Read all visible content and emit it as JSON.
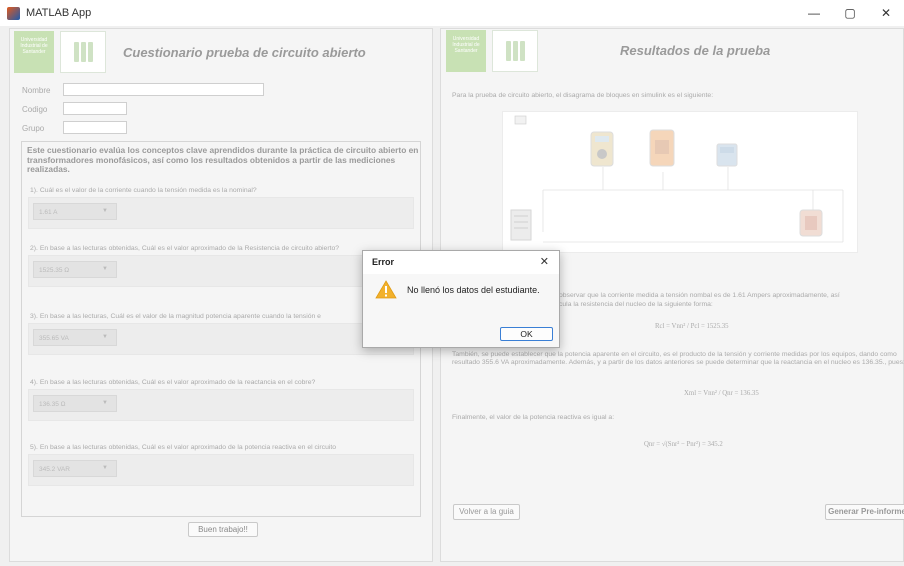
{
  "window": {
    "title": "MATLAB App",
    "minimize": "—",
    "maximize": "▢",
    "close": "✕"
  },
  "left": {
    "logo_text": "Universidad Industrial de Santander",
    "title": "Cuestionario prueba de circuito abierto",
    "fields": {
      "nombre_label": "Nombre",
      "nombre_value": "",
      "codigo_label": "Codigo",
      "codigo_value": "",
      "grupo_label": "Grupo",
      "grupo_value": ""
    },
    "intro": "Este cuestionario evalúa los conceptos clave aprendidos durante la práctica de circuito abierto en transformadores monofásicos, así como los resultados obtenidos a partir de las mediciones realizadas.",
    "questions": [
      {
        "text": "1). Cuál es el valor de la corriente cuando la tensión medida es la nominal?",
        "selected": "1.61 A"
      },
      {
        "text": "2). En base a las lecturas obtenidas, Cuál es el valor aproximado de la Resistencia de circuito abierto?",
        "selected": "1525.35 Ω"
      },
      {
        "text": "3). En base a las lecturas, Cuál es el valor de la magnitud potencia aparente cuando la tensión e",
        "selected": "355.65 VA"
      },
      {
        "text": "4). En base a las lecturas obtenidas, Cuál es el valor aproximado de la reactancia en el cobre?",
        "selected": "136.35 Ω"
      },
      {
        "text": "5). En base a las lecturas obtenidas, Cuál es el valor aproximado de la potencia reactiva en el circuito",
        "selected": "345.2 VAR"
      }
    ],
    "button": "Buen trabajo!!"
  },
  "right": {
    "logo_text": "Universidad Industrial de Santander",
    "title": "Resultados de la prueba",
    "intro": "Para la prueba de circuito abierto, el disagrama de bloques en simulink es el siguiente:",
    "para1": "observar que la corriente medida a tensión nombal es de 1.61 Ampers aproximadamente, así",
    "para1b": "cula la resistencia del nucleo de la siguiente forma:",
    "formula1": "Rcl = Vnn² / Pcl = 1525.35",
    "para2": "También, se puede establecer que la potencia aparente en el circuito, es el producto de la tensión y corriente medidas por los equipos, dando como resultado 355.6 VA aproximadamente. Además, y a partir de los datos anteriores se puede determinar que la reactancia en el nucleo es 136.35., pues:",
    "formula2": "Xml = Vnn² / Qnr = 136.35",
    "para3": "Finalmente, el valor de la potencia reactiva es igual a:",
    "formula3": "Qnr = √(Snr² − Pnr²) = 345.2",
    "button_back": "Volver a la guia",
    "button_generate": "Generar Pre-informe"
  },
  "dialog": {
    "title": "Error",
    "close": "✕",
    "message": "No llenó los datos del estudiante.",
    "ok": "OK"
  }
}
